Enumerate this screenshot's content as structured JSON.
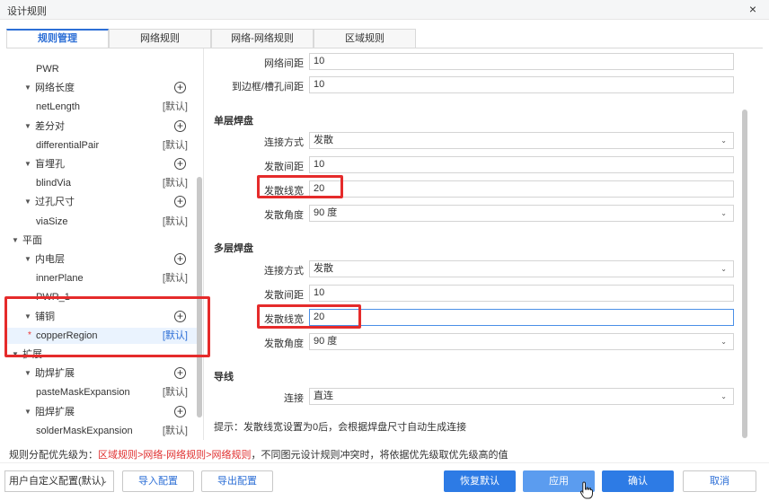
{
  "window": {
    "title": "设计规则",
    "close_glyph": "×"
  },
  "tabs": [
    {
      "label": "规则管理",
      "active": true
    },
    {
      "label": "网络规则",
      "active": false
    },
    {
      "label": "网络-网络规则",
      "active": false
    },
    {
      "label": "区域规则",
      "active": false
    }
  ],
  "tree": {
    "rows": [
      {
        "label": "PWR",
        "indent": 2,
        "tag": ""
      },
      {
        "label": "网络长度",
        "indent": 1,
        "caret": "▼",
        "plus": true
      },
      {
        "label": "netLength",
        "indent": 2,
        "tag": "[默认]"
      },
      {
        "label": "差分对",
        "indent": 1,
        "caret": "▼",
        "plus": true
      },
      {
        "label": "differentialPair",
        "indent": 2,
        "tag": "[默认]"
      },
      {
        "label": "盲埋孔",
        "indent": 1,
        "caret": "▼",
        "plus": true
      },
      {
        "label": "blindVia",
        "indent": 2,
        "tag": "[默认]"
      },
      {
        "label": "过孔尺寸",
        "indent": 1,
        "caret": "▼",
        "plus": true
      },
      {
        "label": "viaSize",
        "indent": 2,
        "tag": "[默认]"
      },
      {
        "label": "平面",
        "indent": 0,
        "caret": "▼"
      },
      {
        "label": "内电层",
        "indent": 1,
        "caret": "▼",
        "plus": true
      },
      {
        "label": "innerPlane",
        "indent": 2,
        "tag": "[默认]"
      },
      {
        "label": "PWR_1",
        "indent": 2,
        "tag": ""
      },
      {
        "label": "铺铜",
        "indent": 1,
        "caret": "▼",
        "plus": true
      },
      {
        "label": "copperRegion",
        "indent": 2,
        "tag": "[默认]",
        "selected": true,
        "star": "*"
      },
      {
        "label": "扩展",
        "indent": 0,
        "caret": "▼"
      },
      {
        "label": "助焊扩展",
        "indent": 1,
        "caret": "▼",
        "plus": true
      },
      {
        "label": "pasteMaskExpansion",
        "indent": 2,
        "tag": "[默认]"
      },
      {
        "label": "阻焊扩展",
        "indent": 1,
        "caret": "▼",
        "plus": true
      },
      {
        "label": "solderMaskExpansion",
        "indent": 2,
        "tag": "[默认]"
      }
    ]
  },
  "form": {
    "top_rows": [
      {
        "label": "网络间距",
        "value": "10"
      },
      {
        "label": "到边框/槽孔间距",
        "value": "10"
      }
    ],
    "single_layer": {
      "title": "单层焊盘",
      "rows": [
        {
          "label": "连接方式",
          "value": "发散",
          "dropdown": true
        },
        {
          "label": "发散间距",
          "value": "10"
        },
        {
          "label": "发散线宽",
          "value": "20"
        },
        {
          "label": "发散角度",
          "value": "90 度",
          "dropdown": true
        }
      ]
    },
    "multi_layer": {
      "title": "多层焊盘",
      "rows": [
        {
          "label": "连接方式",
          "value": "发散",
          "dropdown": true
        },
        {
          "label": "发散间距",
          "value": "10"
        },
        {
          "label": "发散线宽",
          "value": "20",
          "focused": true
        },
        {
          "label": "发散角度",
          "value": "90 度",
          "dropdown": true
        }
      ]
    },
    "wire": {
      "title": "导线",
      "rows": [
        {
          "label": "连接",
          "value": "直连",
          "dropdown": true
        }
      ]
    }
  },
  "hint": "提示：发散线宽设置为0后，会根据焊盘尺寸自动生成连接",
  "priority": {
    "prefix": "规则分配优先级为：",
    "order": "区域规则>网络-网络规则>网络规则",
    "suffix": "，不同图元设计规则冲突时，将依据优先级取优先级高的值"
  },
  "footer": {
    "config_select": "用户自定义配置(默认)",
    "import_label": "导入配置",
    "export_label": "导出配置",
    "restore_label": "恢复默认",
    "apply_label": "应用",
    "ok_label": "确认",
    "cancel_label": "取消"
  },
  "icons": {
    "caret": "▼",
    "dropdown": "⌄",
    "plus": "+"
  },
  "colors": {
    "accent": "#2d7be5",
    "highlight": "#e52b2b",
    "priority_red": "#e03030"
  }
}
